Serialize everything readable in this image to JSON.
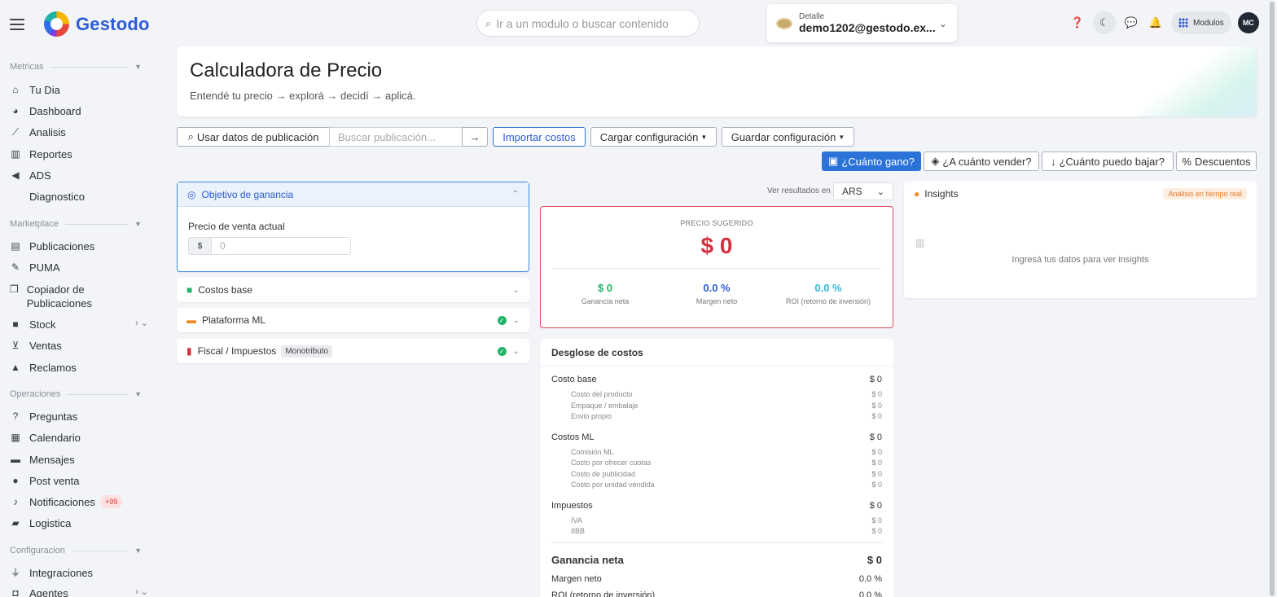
{
  "brand": {
    "name": "Gestodo"
  },
  "search": {
    "placeholder": "Ir a un modulo o buscar contenido"
  },
  "account": {
    "label": "Detalle",
    "email": "demo1202@gestodo.ex..."
  },
  "topbar": {
    "modulos": "Modulos",
    "avatar": "MC"
  },
  "sidebar": {
    "sections": [
      "Metricas",
      "Marketplace",
      "Operaciones",
      "Configuracion"
    ],
    "items": [
      {
        "label": "Tu Dia",
        "icon": "home-icon"
      },
      {
        "label": "Dashboard",
        "icon": "pie-icon"
      },
      {
        "label": "Analisis",
        "icon": "line-chart-icon"
      },
      {
        "label": "Reportes",
        "icon": "bar-chart-icon"
      },
      {
        "label": "ADS",
        "icon": "megaphone-icon"
      },
      {
        "label": "Diagnostico",
        "icon": ""
      },
      {
        "label": "Publicaciones",
        "icon": "file-icon"
      },
      {
        "label": "PUMA",
        "icon": "magic-icon"
      },
      {
        "label": "Copiador de Publicaciones",
        "icon": "copy-icon"
      },
      {
        "label": "Stock",
        "icon": "box-icon"
      },
      {
        "label": "Ventas",
        "icon": "cart-icon"
      },
      {
        "label": "Reclamos",
        "icon": "warning-icon"
      },
      {
        "label": "Preguntas",
        "icon": "question-icon"
      },
      {
        "label": "Calendario",
        "icon": "calendar-icon"
      },
      {
        "label": "Mensajes",
        "icon": "chat-icon"
      },
      {
        "label": "Post venta",
        "icon": "comment-icon"
      },
      {
        "label": "Notificaciones",
        "icon": "bell-icon",
        "badge": "+99"
      },
      {
        "label": "Logistica",
        "icon": "truck-icon"
      },
      {
        "label": "Integraciones",
        "icon": "plug-icon"
      },
      {
        "label": "Agentes",
        "icon": "robot-icon"
      }
    ]
  },
  "header": {
    "title": "Calculadora de Precio",
    "subtitle": "Entendé tu precio → explorá → decidí → aplicá."
  },
  "toolbar": {
    "use_data": "Usar datos de publicación",
    "search_placeholder": "Buscar publicación...",
    "go": "→",
    "import": "Importar costos",
    "load": "Cargar configuración",
    "save": "Guardar configuración"
  },
  "modes": {
    "gain": "¿Cuánto gano?",
    "sell": "¿A cuánto vender?",
    "lower": "¿Cuánto puedo bajar?",
    "discounts": "Descuentos"
  },
  "objective": {
    "title": "Objetivo de ganancia",
    "price_label": "Precio de venta actual",
    "currency_symbol": "$",
    "price_placeholder": "0"
  },
  "accordions": {
    "base": "Costos base",
    "platform": "Plataforma ML",
    "fiscal": "Fiscal / Impuestos",
    "fiscal_tag": "Monotributo"
  },
  "results": {
    "view_label": "Ver resultados en",
    "currency": "ARS",
    "suggested_caption": "PRECIO SUGERIDO",
    "suggested_price": "$ 0",
    "net_gain": "$ 0",
    "net_gain_label": "Ganancia neta",
    "net_margin": "0.0 %",
    "net_margin_label": "Margen neto",
    "roi": "0.0 %",
    "roi_label": "ROI (retorno de inversión)",
    "colors": {
      "gain": "#1fb36a",
      "margin": "#2b5bd7",
      "roi": "#33b9d6",
      "price": "#d2323f"
    }
  },
  "breakdown": {
    "title": "Desglose de costos",
    "base": {
      "label": "Costo base",
      "value": "$ 0",
      "items": [
        {
          "label": "Costo del producto",
          "value": "$ 0"
        },
        {
          "label": "Empaque / embalaje",
          "value": "$ 0"
        },
        {
          "label": "Envio propio",
          "value": "$ 0"
        }
      ]
    },
    "ml": {
      "label": "Costos ML",
      "value": "$ 0",
      "items": [
        {
          "label": "Comisión ML",
          "value": "$ 0"
        },
        {
          "label": "Costo por ofrecer cuotas",
          "value": "$ 0"
        },
        {
          "label": "Costo de publicidad",
          "value": "$ 0"
        },
        {
          "label": "Costo por unidad vendida",
          "value": "$ 0"
        }
      ]
    },
    "tax": {
      "label": "Impuestos",
      "value": "$ 0",
      "items": [
        {
          "label": "IVA",
          "value": "$ 0"
        },
        {
          "label": "IIBB",
          "value": "$ 0"
        }
      ]
    },
    "net_gain": {
      "label": "Ganancia neta",
      "value": "$ 0"
    },
    "net_margin": {
      "label": "Margen neto",
      "value": "0.0 %"
    },
    "roi": {
      "label": "ROI (retorno de inversión)",
      "value": "0.0 %"
    }
  },
  "insights": {
    "title": "Insights",
    "badge": "Análisis en tiempo real",
    "empty": "Ingresá tus datos para ver insights"
  }
}
